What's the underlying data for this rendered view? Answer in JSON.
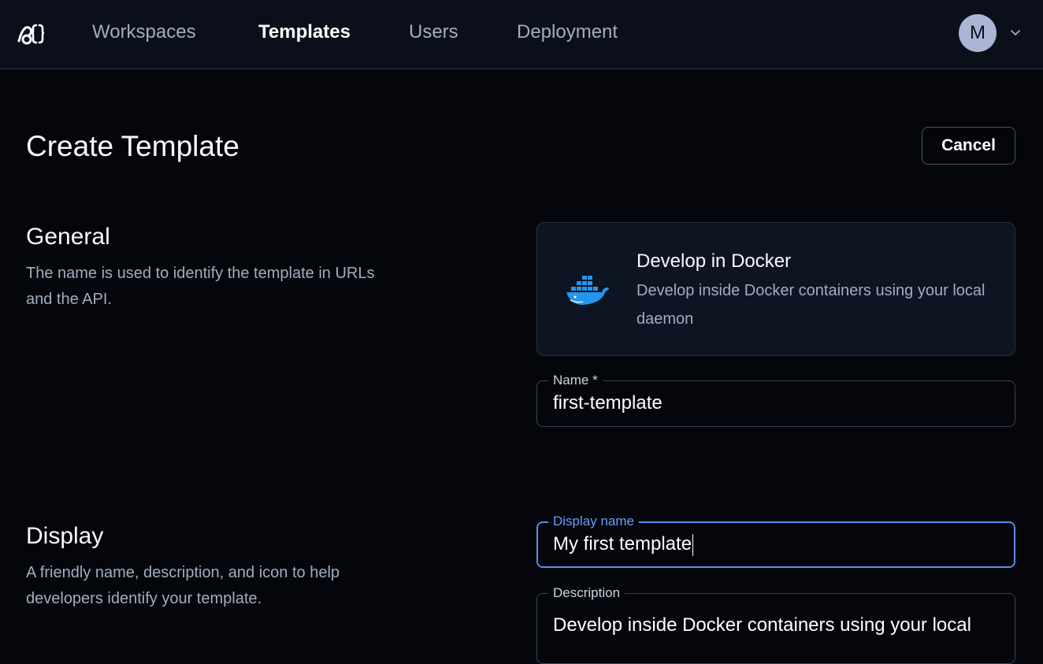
{
  "nav": {
    "items": [
      {
        "label": "Workspaces",
        "active": false
      },
      {
        "label": "Templates",
        "active": true
      },
      {
        "label": "Users",
        "active": false
      },
      {
        "label": "Deployment",
        "active": false
      }
    ],
    "avatar_initial": "M"
  },
  "header": {
    "title": "Create Template",
    "cancel_label": "Cancel"
  },
  "general": {
    "title": "General",
    "description": "The name is used to identify the template in URLs and the API."
  },
  "starter": {
    "title": "Develop in Docker",
    "description": "Develop inside Docker containers using your local daemon"
  },
  "fields": {
    "name": {
      "label": "Name *",
      "value": "first-template"
    },
    "display_name": {
      "label": "Display name",
      "value": "My first template"
    },
    "description": {
      "label": "Description",
      "value": "Develop inside Docker containers using your local"
    }
  },
  "display": {
    "title": "Display",
    "description": "A friendly name, description, and icon to help developers identify your template."
  },
  "colors": {
    "accent": "#5b8def",
    "background": "#05060b",
    "topbar": "#0b0f19",
    "docker_blue": "#2496ed"
  },
  "icons": [
    "coder-logo-icon",
    "chevron-down-icon",
    "docker-icon"
  ]
}
